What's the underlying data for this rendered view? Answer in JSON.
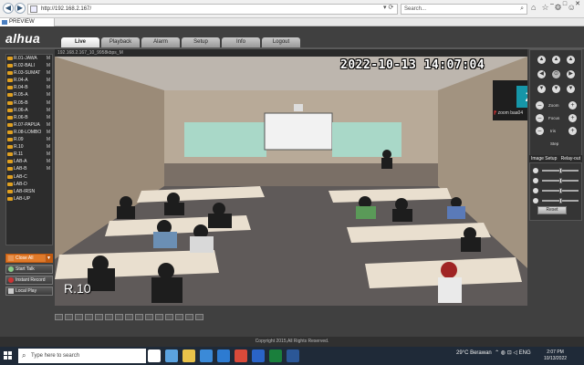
{
  "browser": {
    "url": "http://192.168.2.167/",
    "search_placeholder": "Search...",
    "tab_title": "PREVIEW",
    "back": "◀",
    "forward": "▶",
    "url_tools": "▾ ⟳",
    "search_icon": "⌕",
    "toolbar_icons": [
      "⌂",
      "☆",
      "⚙",
      "☺"
    ],
    "window_controls": [
      "–",
      "□",
      "✕"
    ]
  },
  "app": {
    "logo": "alhua",
    "menu": [
      "Live",
      "Playback",
      "Alarm",
      "Setup",
      "Info",
      "Logout"
    ],
    "active_menu": "Live",
    "cameras": [
      {
        "name": "R.01-JAWA",
        "m": "M"
      },
      {
        "name": "R.02-BALI",
        "m": "M"
      },
      {
        "name": "R.03-SUMAT",
        "m": "M"
      },
      {
        "name": "R.04-A",
        "m": "M"
      },
      {
        "name": "R.04-B",
        "m": "M"
      },
      {
        "name": "R.05-A",
        "m": "M"
      },
      {
        "name": "R.05-B",
        "m": "M"
      },
      {
        "name": "R.06-A",
        "m": "M"
      },
      {
        "name": "R.06-B",
        "m": "M"
      },
      {
        "name": "R.07-PAPUA",
        "m": "M"
      },
      {
        "name": "R.08-LOMBO",
        "m": "M"
      },
      {
        "name": "R.09",
        "m": "M"
      },
      {
        "name": "R.10",
        "m": "M"
      },
      {
        "name": "R.11",
        "m": "M"
      },
      {
        "name": "LAB-A",
        "m": "M"
      },
      {
        "name": "LAB-B",
        "m": "M"
      },
      {
        "name": "LAB-C",
        "m": ""
      },
      {
        "name": "LAB-D",
        "m": ""
      },
      {
        "name": "LAB-IRSN",
        "m": ""
      },
      {
        "name": "LAB-UP",
        "m": ""
      }
    ],
    "buttons": {
      "close_all": "Close All",
      "start_talk": "Start Talk",
      "instant_record": "Instant Record",
      "local_play": "Local Play",
      "close_all_dropdown": "▼"
    },
    "video": {
      "status": "192.168.2.167_10_9958kbps_M",
      "timestamp": "2022-10-13 14:07:04",
      "camera_label": "R.10",
      "zoom_initial": "Z",
      "zoom_caption_prefix": "⁋",
      "zoom_caption": "zoom baa04"
    },
    "ptz": {
      "arrows": [
        "▲",
        "▲",
        "▲",
        "◀",
        "▶",
        "▼",
        "▼",
        "▼",
        "⊙"
      ],
      "rows": [
        "Zoom",
        "Focus",
        "Iris"
      ],
      "minus": "–",
      "plus": "+",
      "step_label": "Step"
    },
    "image_setup": {
      "title": "Image Setup",
      "relay_out": "Relay-out",
      "reset": "Reset",
      "sliders": [
        {
          "name": "brightness",
          "value": 0.5
        },
        {
          "name": "contrast",
          "value": 0.5
        },
        {
          "name": "saturation",
          "value": 0.5
        },
        {
          "name": "hue",
          "value": 0.5
        }
      ]
    },
    "footer": "Copyright 2015,All Rights Reserved."
  },
  "taskbar": {
    "search_placeholder": "Type here to search",
    "search_icon": "⌕",
    "weather": "29°C  Berawan",
    "tray_icons": "⌃ ◍ ⊡ ◁ ENG",
    "time": "2:07 PM",
    "date": "10/13/2022"
  }
}
